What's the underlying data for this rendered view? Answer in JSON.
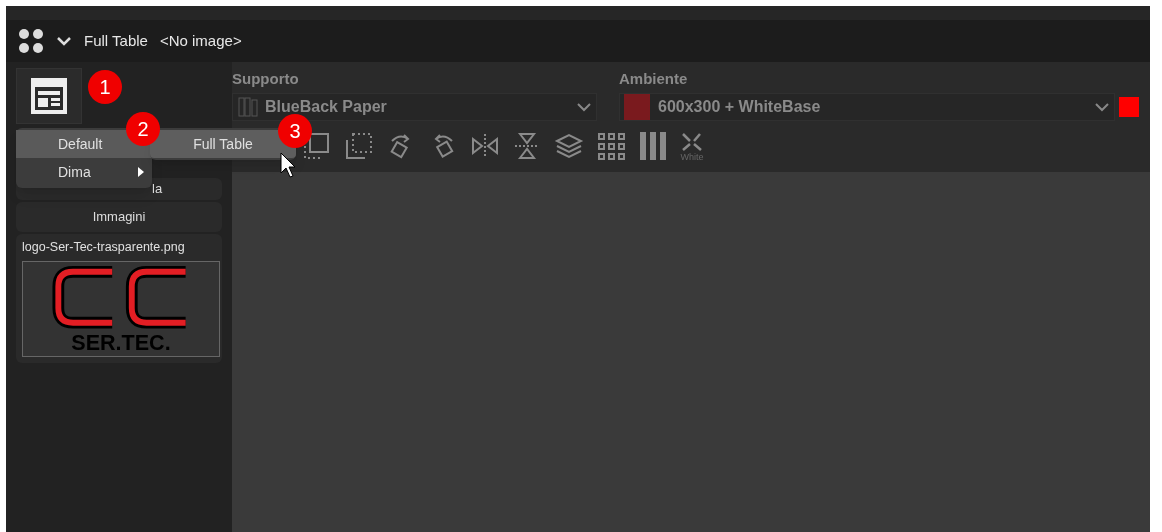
{
  "title_bar": {
    "title": "Full Table",
    "image": "<No image>"
  },
  "supporto": {
    "label": "Supporto",
    "value": "BlueBack Paper"
  },
  "ambiente": {
    "label": "Ambiente",
    "value": "600x300 + WhiteBase",
    "color": "#7a1a1e"
  },
  "menu": {
    "items": [
      {
        "label": "Default",
        "selected": true,
        "has_submenu": false
      },
      {
        "label": "Dima",
        "selected": false,
        "has_submenu": true
      }
    ],
    "submenu": [
      {
        "label": "Full Table",
        "selected": true
      }
    ]
  },
  "callouts": [
    "1",
    "2",
    "3"
  ],
  "toolbar": {
    "white_label": "White"
  },
  "panel": {
    "partial_tab": "la",
    "images_header": "Immagini",
    "file_name": "logo-Ser-Tec-trasparente.png",
    "logo_text": "SER.TEC."
  }
}
